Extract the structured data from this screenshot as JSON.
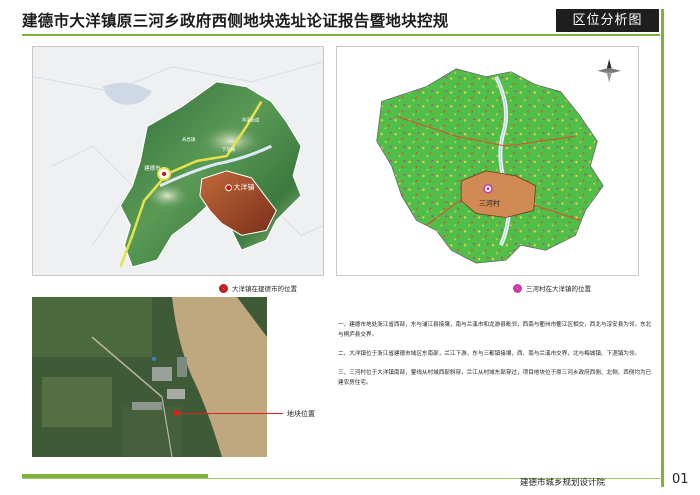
{
  "header": {
    "title": "建德市大洋镇原三河乡政府西侧地块选址论证报告暨地块控规",
    "section_tag": "区位分析图"
  },
  "map_left": {
    "labels": {
      "county": "建德市",
      "town": "大洋镇",
      "place_1": "寿昌镇",
      "place_2": "洋溪街道",
      "place_3": "下涯镇"
    },
    "legend": "大洋镇在建德市的位置"
  },
  "map_right": {
    "labels": {
      "village": "三河村"
    },
    "legend": "三河村在大洋镇的位置"
  },
  "satellite": {
    "callout": "地块位置"
  },
  "description": [
    "一、建德市地处浙江省西部，东与浦江县接壤，南与兰溪市和龙游县毗邻，西南与衢州市衢江区相交，西北与淳安县为邻，东北与桐庐县交界。",
    "二、大洋镇位于浙江省建德市域区东南部，兰江下游，东与三都镇接壤，西、南与兰溪市交界，北与梅城镇、下涯镇为邻。",
    "三、三河村位于大洋镇南部，蓥线从村域西部斜穿，兰江从村域东部穿过，项目地块位于原三河乡政府西侧、北侧、西侧均为已建农房住宅。"
  ],
  "footer": {
    "institute": "建德市城乡规划设计院",
    "page": "01"
  },
  "colors": {
    "accent": "#7fb23a",
    "marker_red": "#c11b1b",
    "marker_purple": "#c53aa6"
  }
}
